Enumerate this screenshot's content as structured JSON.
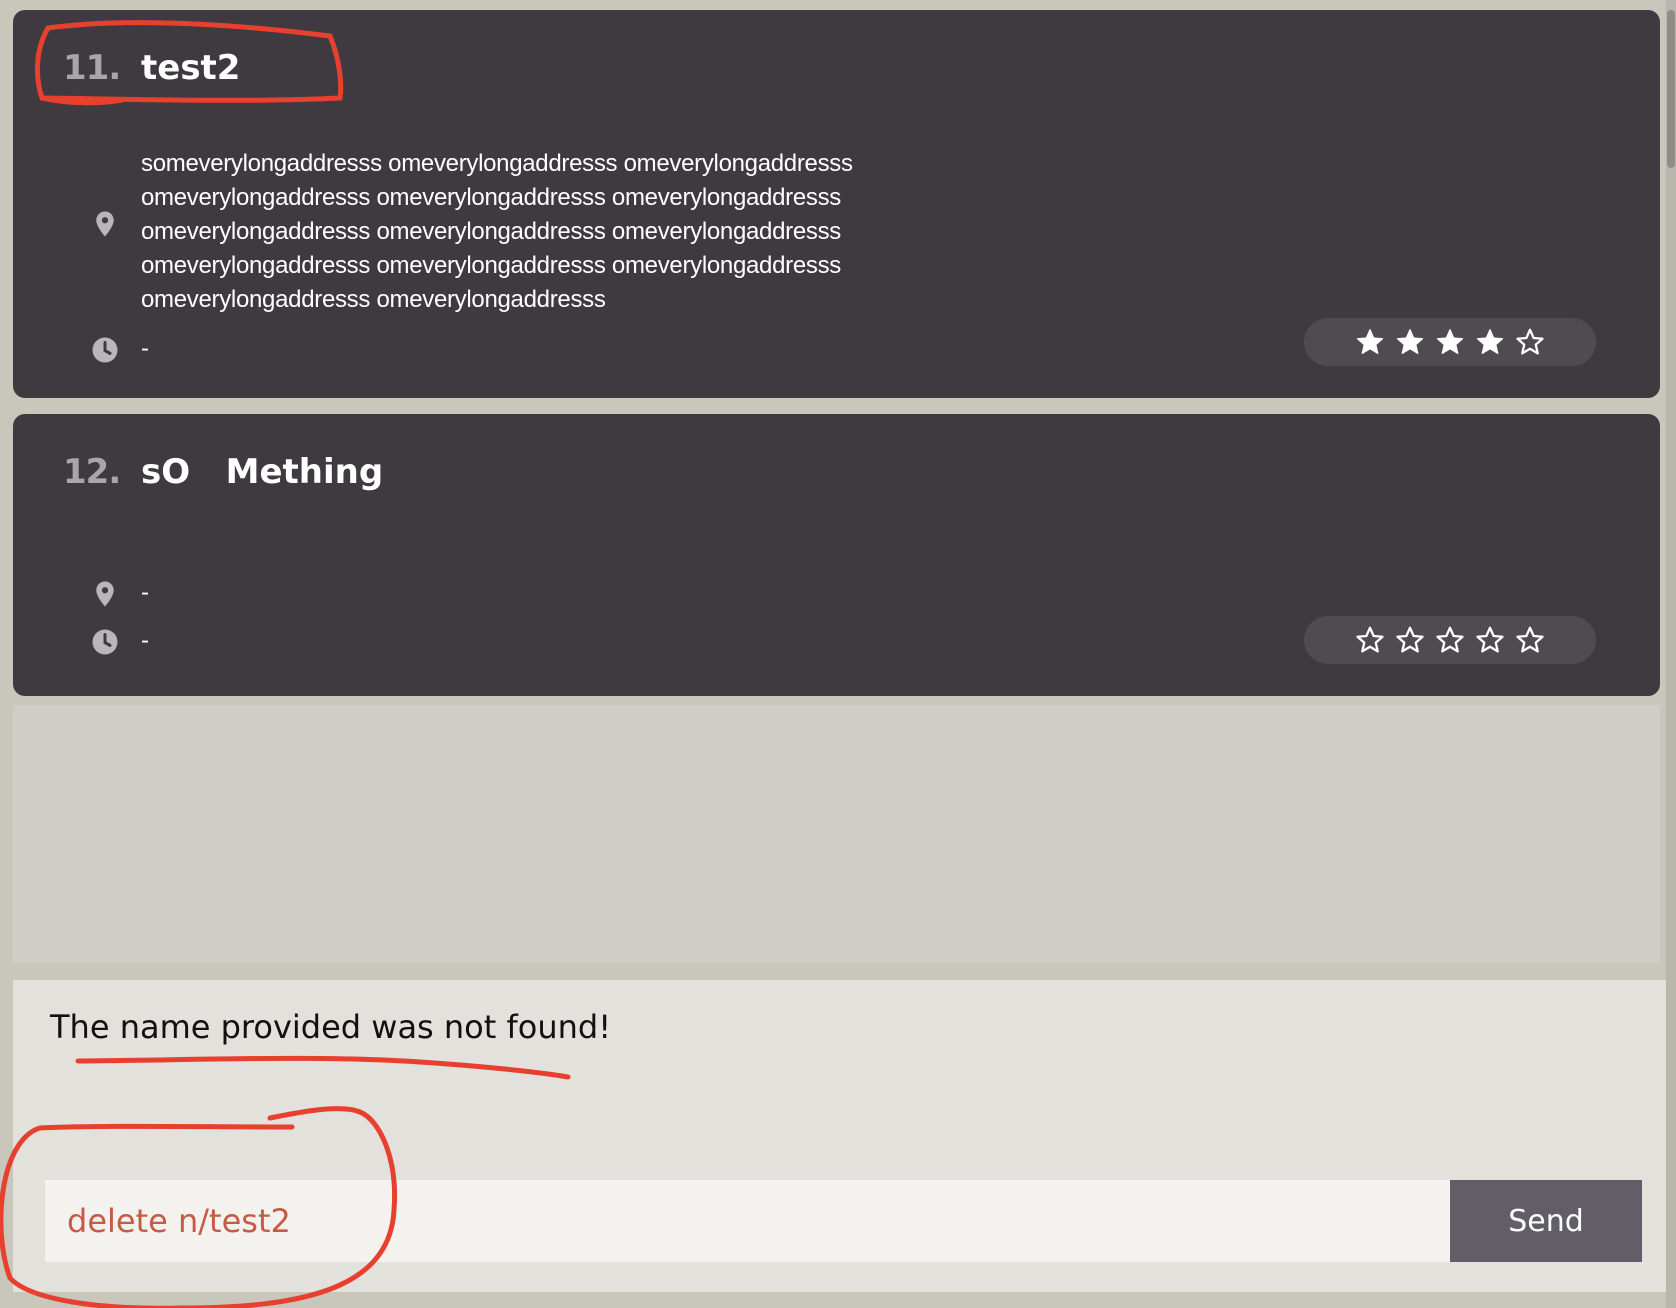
{
  "cards": [
    {
      "index": "11.",
      "name": "test2",
      "address": "someverylongaddresss  omeverylongaddresss   omeverylongaddresss omeverylongaddresss  omeverylongaddresss  omeverylongaddresss omeverylongaddresss  omeverylongaddresss  omeverylongaddresss omeverylongaddresss  omeverylongaddresss  omeverylongaddresss omeverylongaddresss  omeverylongaddresss",
      "time": "-",
      "rating": 4,
      "rating_max": 5
    },
    {
      "index": "12.",
      "name": "sO   Mething",
      "address": "-",
      "time": "-",
      "rating": 0,
      "rating_max": 5
    }
  ],
  "result": {
    "message": "The name provided was not found!"
  },
  "command": {
    "value": "delete n/test2",
    "send_label": "Send"
  },
  "icons": {
    "address": "map-pin-icon",
    "time": "clock-icon",
    "star_filled": "star-filled-icon",
    "star_empty": "star-outline-icon"
  },
  "colors": {
    "card_bg": "#3e3a40",
    "page_bg": "#c9c6bc",
    "command_text": "#c55a45",
    "send_bg": "#625e68",
    "annotation": "#e8402f"
  }
}
